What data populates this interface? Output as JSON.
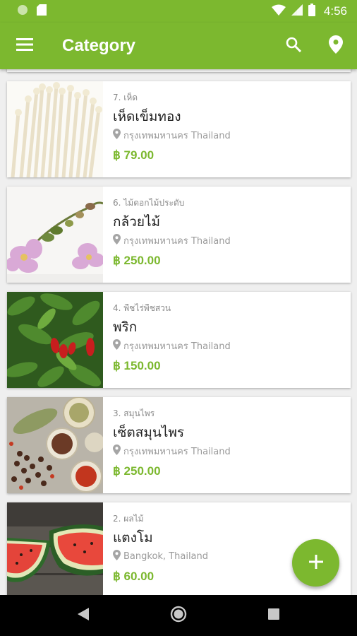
{
  "status_bar": {
    "time": "4:56",
    "icons": [
      "circle-icon",
      "sd-card-icon",
      "wifi-icon",
      "signal-icon",
      "battery-icon"
    ]
  },
  "app_bar": {
    "title": "Category",
    "icons": [
      "menu-icon",
      "search-icon",
      "location-pin-icon"
    ]
  },
  "colors": {
    "primary": "#7cb82f",
    "background": "#efefef",
    "card": "#ffffff"
  },
  "items": [
    {
      "category": "7. เห็ด",
      "title": "เห็ดเข็มทอง",
      "location": "กรุงเทพมหานคร Thailand",
      "price": "฿ 79.00",
      "image": "enoki-mushroom-image"
    },
    {
      "category": "6. ไม้ดอกไม้ประดับ",
      "title": "กล้วยไม้",
      "location": "กรุงเทพมหานคร Thailand",
      "price": "฿ 250.00",
      "image": "orchid-image"
    },
    {
      "category": "4. พืชไร่พืชสวน",
      "title": "พริก",
      "location": "กรุงเทพมหานคร Thailand",
      "price": "฿ 150.00",
      "image": "chili-plant-image"
    },
    {
      "category": "3. สมุนไพร",
      "title": "เซ็ตสมุนไพร",
      "location": "กรุงเทพมหานคร Thailand",
      "price": "฿ 250.00",
      "image": "herb-spices-image"
    },
    {
      "category": "2. ผลไม้",
      "title": "แตงโม",
      "location": "Bangkok, Thailand",
      "price": "฿ 60.00",
      "image": "watermelon-image"
    }
  ],
  "fab": {
    "icon": "plus-icon"
  },
  "nav_bar": {
    "icons": [
      "back-icon",
      "home-icon",
      "recents-icon"
    ]
  }
}
